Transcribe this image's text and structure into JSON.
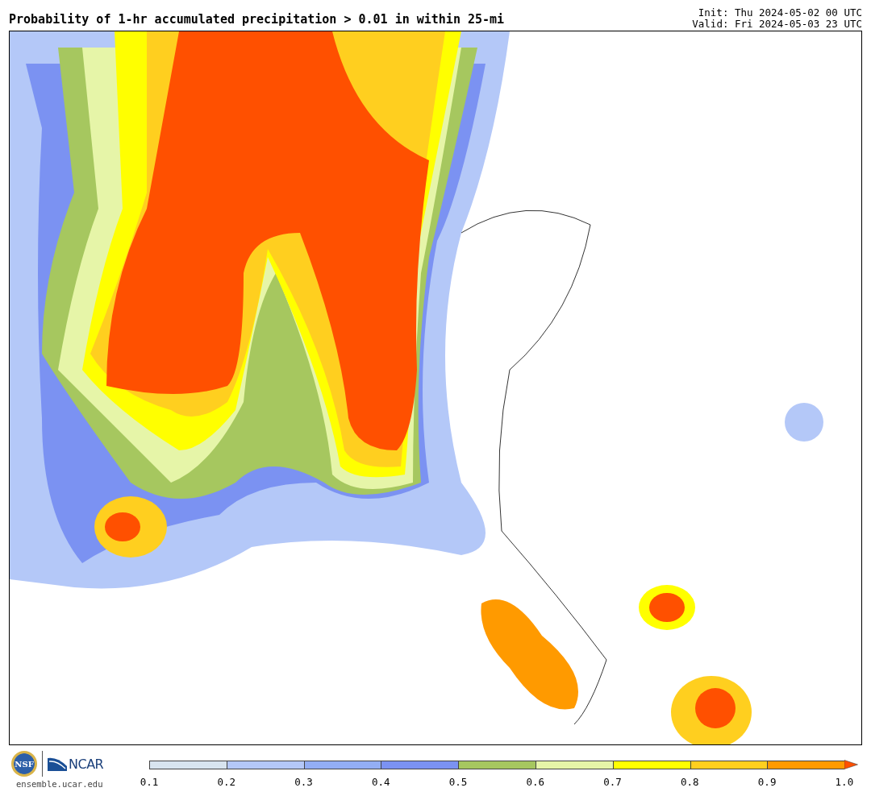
{
  "title": "Probability of 1-hr accumulated precipitation > 0.01 in within 25-mi",
  "init": "Init: Thu 2024-05-02 00 UTC",
  "valid": "Valid: Fri 2024-05-03 23 UTC",
  "logos": {
    "nsf": "NSF",
    "ncar": "NCAR",
    "url": "ensemble.ucar.edu"
  },
  "colorbar": {
    "bins": [
      {
        "color": "#d8e4ef"
      },
      {
        "color": "#b4c8f8"
      },
      {
        "color": "#93aef4"
      },
      {
        "color": "#7b92f2"
      },
      {
        "color": "#a6c75f"
      },
      {
        "color": "#e6f5a8"
      },
      {
        "color": "#ffff00"
      },
      {
        "color": "#ffcf1f"
      },
      {
        "color": "#ff9a00"
      },
      {
        "kind": "arrow",
        "color": "#ff5000"
      }
    ],
    "ticks": [
      "0.1",
      "0.2",
      "0.3",
      "0.4",
      "0.5",
      "0.6",
      "0.7",
      "0.8",
      "0.9",
      "1.0"
    ]
  }
}
